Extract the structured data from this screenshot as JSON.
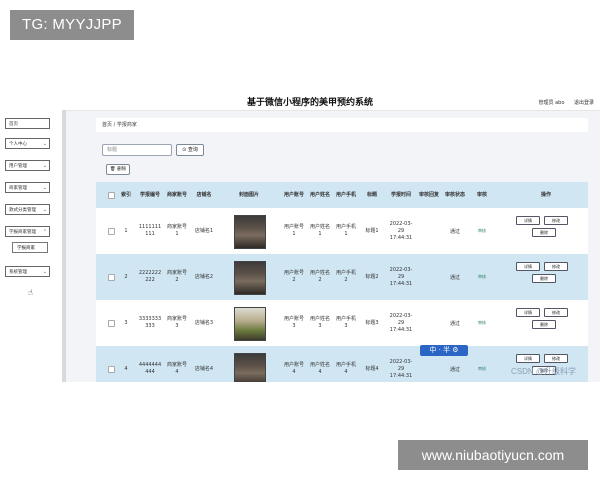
{
  "watermarks": {
    "tg": "TG: MYYJJPP",
    "url": "www.niubaotiyucn.com",
    "csdn": "CSDN @升级科学",
    "ime": "中 · 半 ⚙"
  },
  "header": {
    "title": "基于微信小程序的美甲预约系统",
    "user_role": "管理员 abo",
    "logout": "退出登录"
  },
  "sidebar": {
    "items": [
      {
        "label": "首页"
      },
      {
        "label": "个人中心"
      },
      {
        "label": "用户管理"
      },
      {
        "label": "商家管理"
      },
      {
        "label": "款式分类管理"
      },
      {
        "label": "学报商家管理"
      },
      {
        "label": "学报商家"
      },
      {
        "label": "系统管理"
      }
    ]
  },
  "breadcrumb": {
    "text": "首页 / 学报商家"
  },
  "search": {
    "placeholder": "标题",
    "button": "查询"
  },
  "toolbar": {
    "delete": "删除"
  },
  "table": {
    "headers": [
      "索引",
      "学报编号",
      "商家账号",
      "店铺名",
      "封面图片",
      "用户账号",
      "用户姓名",
      "用户手机",
      "标题",
      "学报时间",
      "审核回复",
      "审核状态",
      "审核",
      "操作"
    ],
    "rows": [
      {
        "index": "1",
        "code": "1111111 111",
        "account": "商家账号1",
        "shop": "店铺名1",
        "user_acc": "用户账号1",
        "user_name": "用户姓名1",
        "phone": "用户手机1",
        "title": "标题1",
        "time": "2022-03-29 17:44:31",
        "status": "通过",
        "audit": "审核"
      },
      {
        "index": "2",
        "code": "2222222 222",
        "account": "商家账号2",
        "shop": "店铺名2",
        "user_acc": "用户账号2",
        "user_name": "用户姓名2",
        "phone": "用户手机2",
        "title": "标题2",
        "time": "2022-03-29 17:44:31",
        "status": "通过",
        "audit": "审核"
      },
      {
        "index": "3",
        "code": "3333333 333",
        "account": "商家账号3",
        "shop": "店铺名3",
        "user_acc": "用户账号3",
        "user_name": "用户姓名3",
        "phone": "用户手机3",
        "title": "标题3",
        "time": "2022-03-29 17:44:31",
        "status": "通过",
        "audit": "审核"
      },
      {
        "index": "4",
        "code": "4444444 444",
        "account": "商家账号4",
        "shop": "店铺名4",
        "user_acc": "用户账号4",
        "user_name": "用户姓名4",
        "phone": "用户手机4",
        "title": "标题4",
        "time": "2022-03-29 17:44:31",
        "status": "通过",
        "audit": "审核"
      }
    ],
    "ops": {
      "detail": "详情",
      "edit": "修改",
      "delete": "删除"
    }
  }
}
